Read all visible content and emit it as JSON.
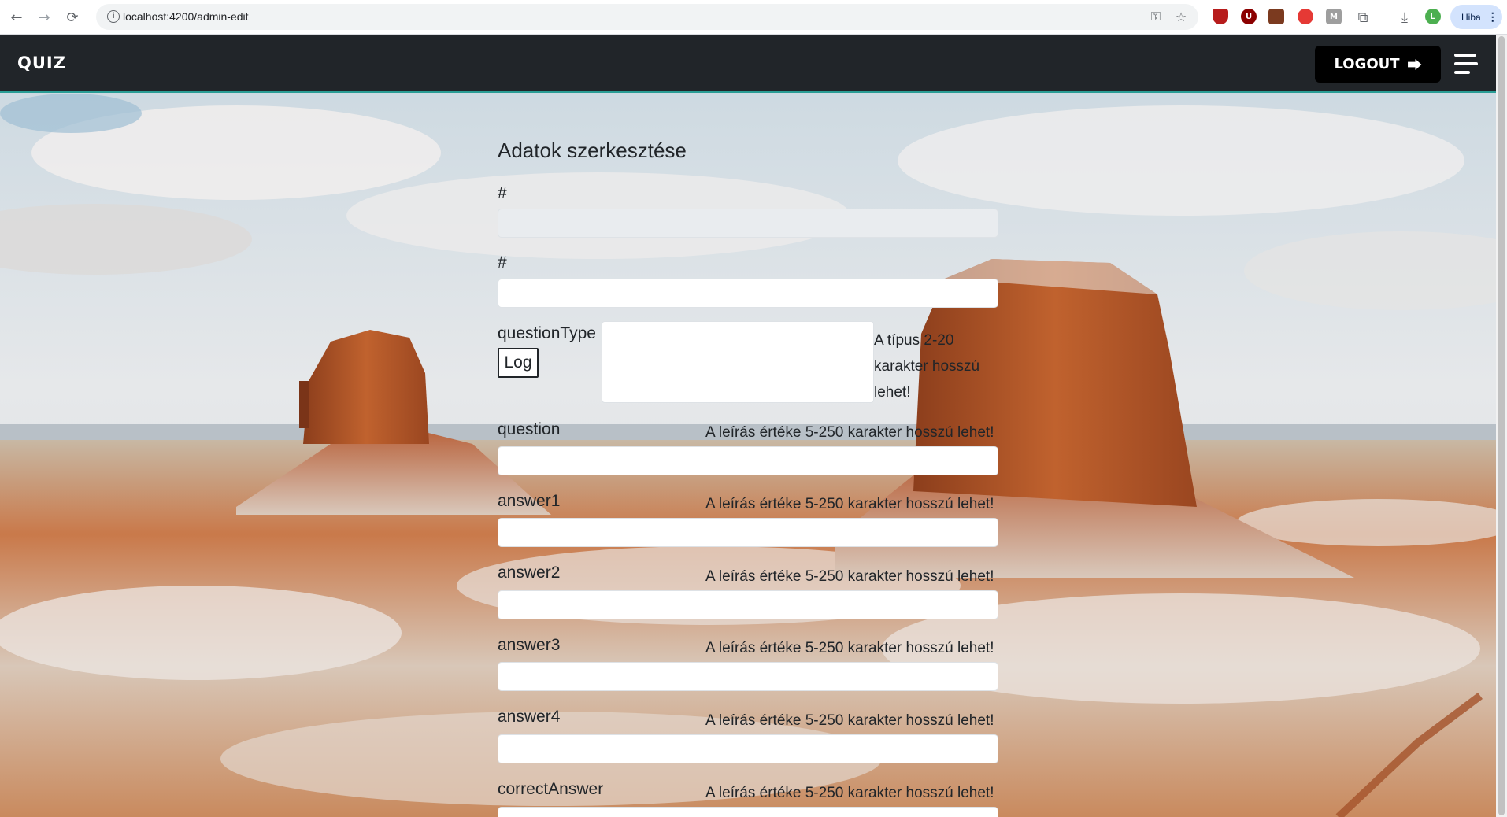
{
  "browser": {
    "url": "localhost:4200/admin-edit",
    "back_icon": "←",
    "forward_icon": "→",
    "reload_icon": "⟳",
    "info_icon": "i",
    "password_icon": "⚿",
    "star_icon": "☆",
    "puzzle_icon": "⧉",
    "download_icon": "⤓",
    "profile_initial": "L",
    "error_chip_label": "Hiba",
    "menu_dots": "⋮"
  },
  "navbar": {
    "brand": "QUIZ",
    "logout_label": "LOGOUT",
    "logout_icon": "⮕"
  },
  "form": {
    "title": "Adatok szerkesztése",
    "id_label": "#",
    "id_value": "",
    "field2_label": "#",
    "field2_value": "",
    "question_type_label": "questionType",
    "log_button_label": "Log",
    "question_type_error": "A típus 2-20 karakter hosszú lehet!",
    "question_label": "question",
    "answer1_label": "answer1",
    "answer2_label": "answer2",
    "answer3_label": "answer3",
    "answer4_label": "answer4",
    "correct_answer_label": "correctAnswer",
    "description_error": "A leírás értéke 5-250 karakter hosszú lehet!"
  },
  "colors": {
    "navbar_bg": "#212529",
    "navbar_accent": "#2a9d95",
    "text": "#212529",
    "disabled_input_bg": "#e9ecef"
  }
}
